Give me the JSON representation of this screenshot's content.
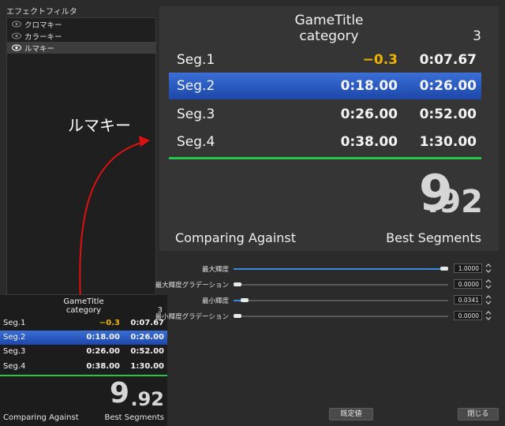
{
  "filters": {
    "title": "エフェクトフィルタ",
    "items": [
      {
        "label": "クロマキー",
        "selected": false
      },
      {
        "label": "カラーキー",
        "selected": false
      },
      {
        "label": "ルマキー",
        "selected": true
      }
    ]
  },
  "annotation": {
    "label": "ルマキー"
  },
  "splits": {
    "game_title": "GameTitle",
    "category": "category",
    "attempts": "3",
    "segments": [
      {
        "name": "Seg.1",
        "delta": "−0.3",
        "time": "0:07.67",
        "active": false
      },
      {
        "name": "Seg.2",
        "delta": "0:18.00",
        "time": "0:26.00",
        "active": true
      },
      {
        "name": "Seg.3",
        "delta": "0:26.00",
        "time": "0:52.00",
        "active": false
      },
      {
        "name": "Seg.4",
        "delta": "0:38.00",
        "time": "1:30.00",
        "active": false
      }
    ],
    "timer_main": "9",
    "timer_fraction": ".92",
    "comparing_label": "Comparing Against",
    "comparing_value": "Best Segments"
  },
  "properties": [
    {
      "label": "最大輝度",
      "value": "1.0000",
      "fill": 1.0
    },
    {
      "label": "最大輝度グラデーション",
      "value": "0.0000",
      "fill": 0.0
    },
    {
      "label": "最小輝度",
      "value": "0.0341",
      "fill": 0.0341
    },
    {
      "label": "最小輝度グラデーション",
      "value": "0.0000",
      "fill": 0.0
    }
  ],
  "buttons": {
    "defaults": "既定値",
    "close": "閉じる"
  },
  "colors": {
    "accent_blue": "#3a8ae0",
    "split_green": "#22c84a",
    "gold": "#f0b400"
  }
}
